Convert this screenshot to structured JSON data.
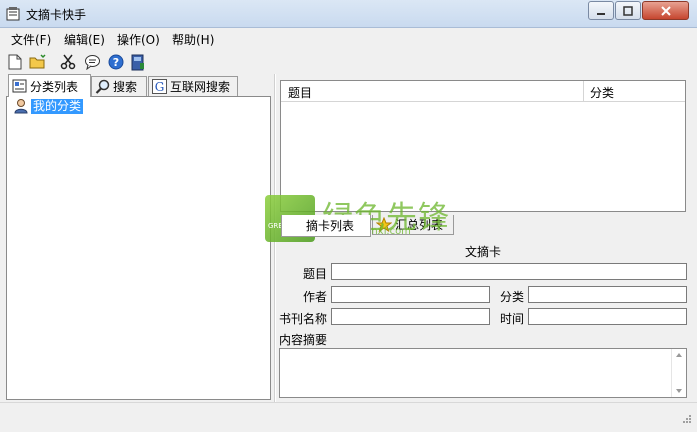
{
  "window": {
    "title": "文摘卡快手",
    "controls": [
      "minimize-icon",
      "maximize-icon",
      "close-icon"
    ]
  },
  "menu": [
    {
      "label": "文件(F)"
    },
    {
      "label": "编辑(E)"
    },
    {
      "label": "操作(O)"
    },
    {
      "label": "帮助(H)"
    }
  ],
  "toolbar": {
    "icons": [
      "new-file-icon",
      "open-folder-icon",
      "scissors-icon",
      "comment-icon",
      "help-icon",
      "book-icon"
    ]
  },
  "left_tabs": [
    {
      "label": "分类列表",
      "active": true,
      "icon": "category-list-icon"
    },
    {
      "label": "搜索",
      "active": false,
      "icon": "magnifier-icon"
    },
    {
      "label": "互联网搜索",
      "active": false,
      "icon": "google-g-icon"
    }
  ],
  "tree": {
    "root_label": "我的分类",
    "icon": "user-icon",
    "selected": true
  },
  "list": {
    "columns": [
      "题目",
      "分类"
    ],
    "rows": []
  },
  "bottom_tabs": [
    {
      "label": "摘卡列表",
      "active": true
    },
    {
      "label": "汇总列表",
      "active": false,
      "icon": "star-icon"
    }
  ],
  "form": {
    "title": "文摘卡",
    "fields": {
      "title": {
        "label": "题目",
        "value": ""
      },
      "author": {
        "label": "作者",
        "value": ""
      },
      "category": {
        "label": "分类",
        "value": ""
      },
      "publication": {
        "label": "书刊名称",
        "value": ""
      },
      "time": {
        "label": "时间",
        "value": ""
      },
      "summary": {
        "label": "内容摘要",
        "value": ""
      }
    }
  },
  "watermark": {
    "name": "绿色先锋",
    "url": "www.greenxf.com",
    "logo_text": "GREENXF .COM"
  },
  "colors": {
    "selection": "#3399ff",
    "watermark_green": "#6bb62b"
  }
}
